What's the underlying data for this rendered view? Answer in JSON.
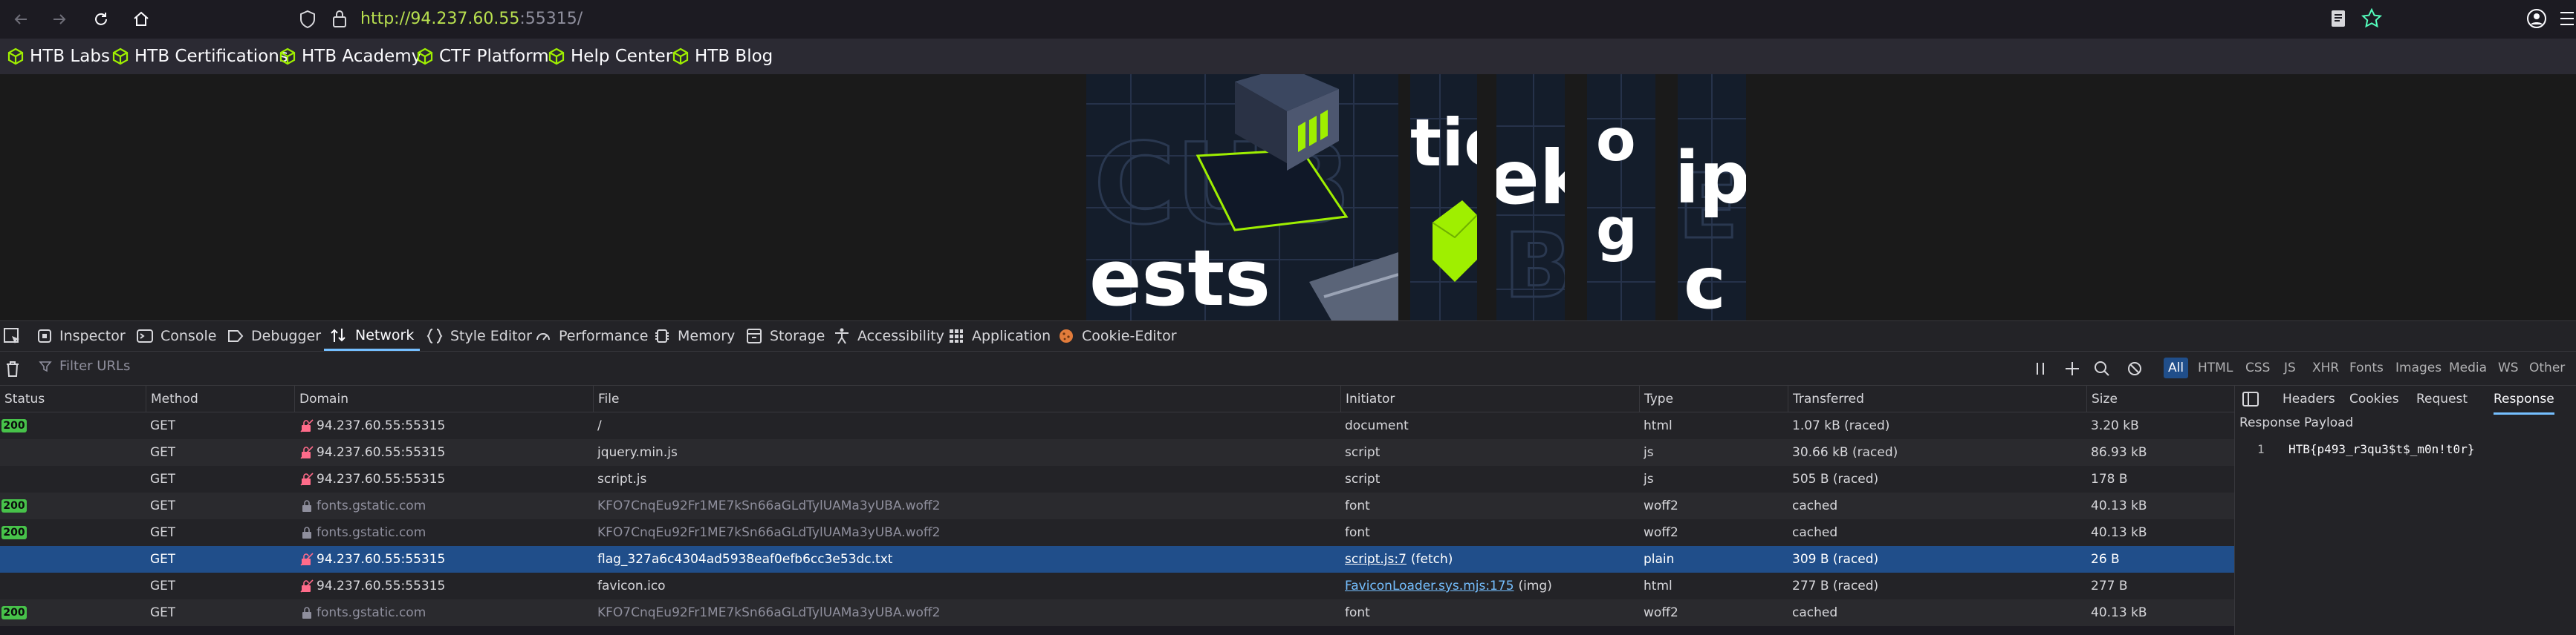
{
  "browser": {
    "url_scheme": "http://",
    "url_host": "94.237.60.55",
    "url_port": ":55315/"
  },
  "bookmarks": [
    {
      "label": "HTB Labs"
    },
    {
      "label": "HTB Certifications"
    },
    {
      "label": "HTB Academy"
    },
    {
      "label": "CTF Platform"
    },
    {
      "label": "Help Center"
    },
    {
      "label": "HTB Blog"
    }
  ],
  "page": {
    "tile1_text": "ests",
    "tile2_text": "tic",
    "tile3_text": "ek",
    "tile4_text": "o",
    "tile4_text2": "g",
    "tile5_text": "ip",
    "tile5_text2": "c"
  },
  "devtools": {
    "tabs": [
      {
        "label": "Inspector",
        "icon": "inspector-icon"
      },
      {
        "label": "Console",
        "icon": "console-icon"
      },
      {
        "label": "Debugger",
        "icon": "debugger-icon"
      },
      {
        "label": "Network",
        "icon": "network-icon"
      },
      {
        "label": "Style Editor",
        "icon": "style-editor-icon"
      },
      {
        "label": "Performance",
        "icon": "performance-icon"
      },
      {
        "label": "Memory",
        "icon": "memory-icon"
      },
      {
        "label": "Storage",
        "icon": "storage-icon"
      },
      {
        "label": "Accessibility",
        "icon": "accessibility-icon"
      },
      {
        "label": "Application",
        "icon": "application-icon"
      },
      {
        "label": "Cookie-Editor",
        "icon": "cookie-icon"
      }
    ],
    "active_tab": "Network",
    "filter_placeholder": "Filter URLs",
    "type_filters": [
      "All",
      "HTML",
      "CSS",
      "JS",
      "XHR",
      "Fonts",
      "Images",
      "Media",
      "WS",
      "Other"
    ],
    "columns": [
      "Status",
      "Method",
      "Domain",
      "File",
      "Initiator",
      "Type",
      "Transferred",
      "Size"
    ],
    "rows": [
      {
        "status": "200",
        "method": "GET",
        "domain": "94.237.60.55:55315",
        "file": "/",
        "initiator": "document",
        "initiator_extra": "",
        "type": "html",
        "transferred": "1.07 kB (raced)",
        "size": "3.20 kB"
      },
      {
        "status": "",
        "method": "GET",
        "domain": "94.237.60.55:55315",
        "file": "jquery.min.js",
        "initiator": "script",
        "initiator_extra": "",
        "type": "js",
        "transferred": "30.66 kB (raced)",
        "size": "86.93 kB"
      },
      {
        "status": "",
        "method": "GET",
        "domain": "94.237.60.55:55315",
        "file": "script.js",
        "initiator": "script",
        "initiator_extra": "",
        "type": "js",
        "transferred": "505 B (raced)",
        "size": "178 B"
      },
      {
        "status": "200",
        "method": "GET",
        "domain": "fonts.gstatic.com",
        "file": "KFO7CnqEu92Fr1ME7kSn66aGLdTylUAMa3yUBA.woff2",
        "initiator": "font",
        "initiator_extra": "",
        "type": "woff2",
        "transferred": "cached",
        "size": "40.13 kB"
      },
      {
        "status": "200",
        "method": "GET",
        "domain": "fonts.gstatic.com",
        "file": "KFO7CnqEu92Fr1ME7kSn66aGLdTylUAMa3yUBA.woff2",
        "initiator": "font",
        "initiator_extra": "",
        "type": "woff2",
        "transferred": "cached",
        "size": "40.13 kB"
      },
      {
        "status": "",
        "method": "GET",
        "domain": "94.237.60.55:55315",
        "file": "flag_327a6c4304ad5938eaf0efb6cc3e53dc.txt",
        "initiator": "script.js:7",
        "initiator_extra": "(fetch)",
        "type": "plain",
        "transferred": "309 B (raced)",
        "size": "26 B"
      },
      {
        "status": "",
        "method": "GET",
        "domain": "94.237.60.55:55315",
        "file": "favicon.ico",
        "initiator": "FaviconLoader.sys.mjs:175",
        "initiator_extra": "(img)",
        "type": "html",
        "transferred": "277 B (raced)",
        "size": "277 B"
      },
      {
        "status": "200",
        "method": "GET",
        "domain": "fonts.gstatic.com",
        "file": "KFO7CnqEu92Fr1ME7kSn66aGLdTylUAMa3yUBA.woff2",
        "initiator": "font",
        "initiator_extra": "",
        "type": "woff2",
        "transferred": "cached",
        "size": "40.13 kB"
      }
    ],
    "selected_row": 5,
    "side_tabs": [
      "Headers",
      "Cookies",
      "Request",
      "Response"
    ],
    "side_active": "Response",
    "payload_label": "Response Payload",
    "payload_line_no": "1",
    "payload_text": "HTB{p493_r3qu3$t$_m0n!t0r}"
  },
  "colors": {
    "accent": "#75bfff",
    "status_ok": "#47c24a",
    "url_host": "#b8e04f",
    "htb_green": "#9fef00",
    "selected_row": "#204e8a"
  }
}
